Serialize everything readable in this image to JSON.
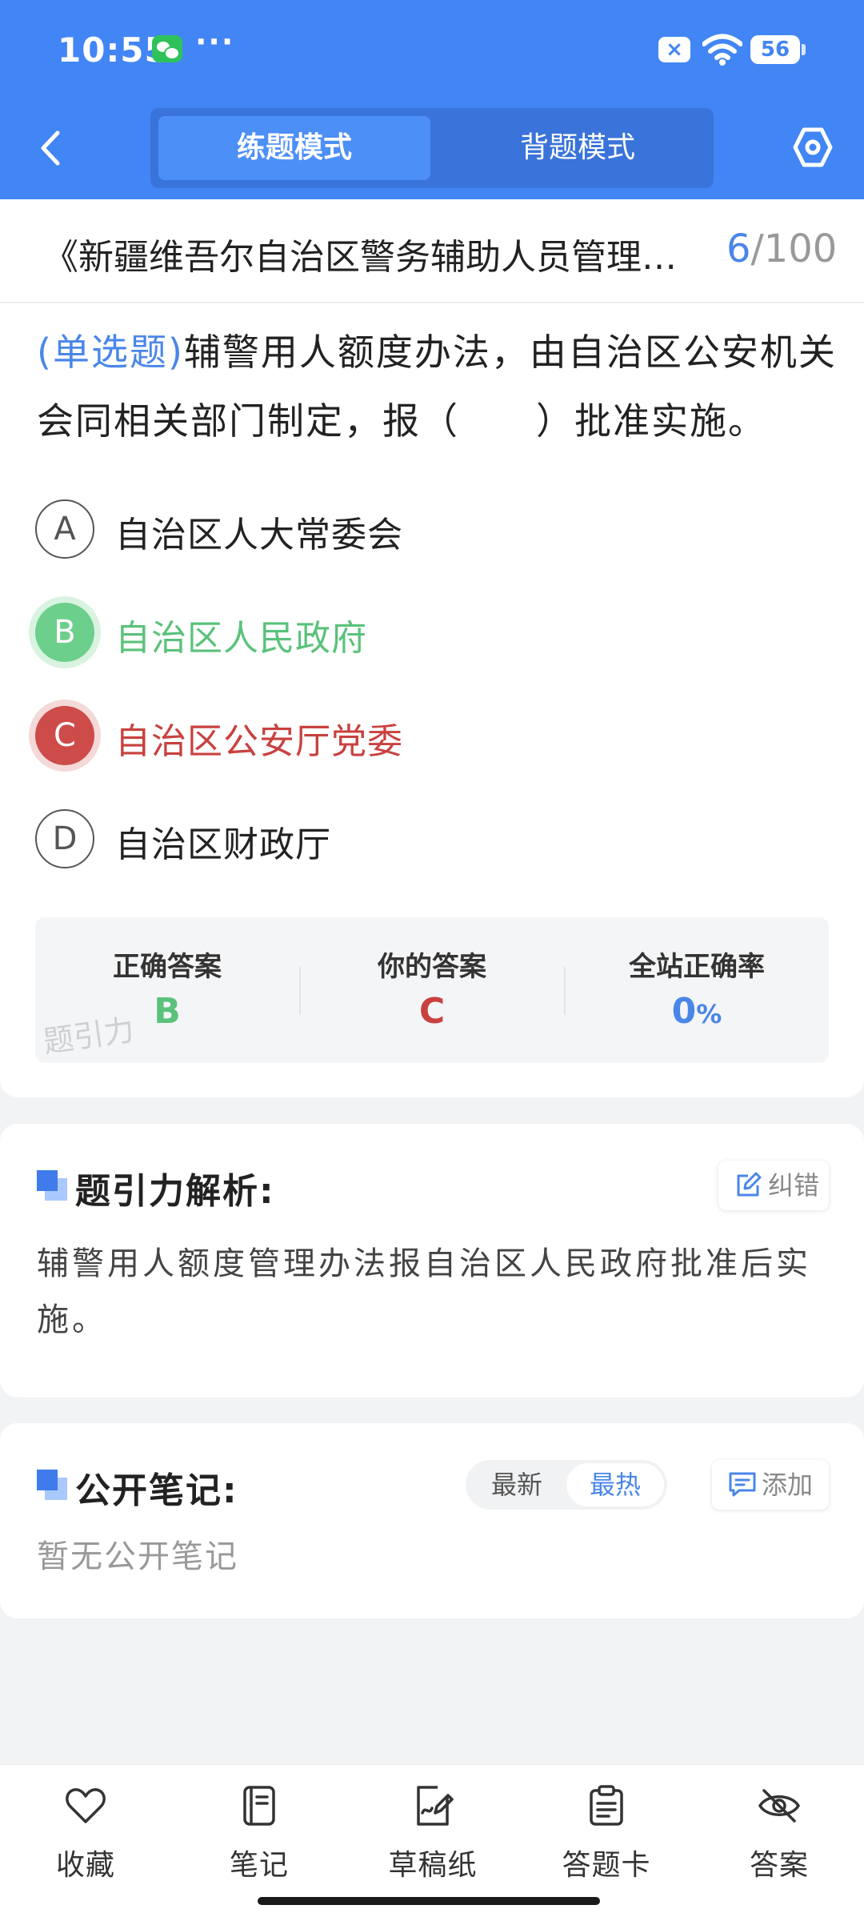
{
  "status_bar": {
    "time": "10:55",
    "dots": "···",
    "sim_badge": "×",
    "battery": "56"
  },
  "header": {
    "mode_practice": "练题模式",
    "mode_memorize": "背题模式"
  },
  "question": {
    "doc_title": "《新疆维吾尔自治区警务辅助人员管理办法》",
    "current": "6",
    "separator": "/",
    "total": "100",
    "type_label": "(单选题)",
    "text": "辅警用人额度办法，由自治区公安机关会同相关部门制定，报（　　）批准实施。",
    "options": [
      {
        "letter": "A",
        "text": "自治区人大常委会",
        "state": "normal"
      },
      {
        "letter": "B",
        "text": "自治区人民政府",
        "state": "correct"
      },
      {
        "letter": "C",
        "text": "自治区公安厅党委",
        "state": "wrong"
      },
      {
        "letter": "D",
        "text": "自治区财政厅",
        "state": "normal"
      }
    ]
  },
  "answer_summary": {
    "correct_label": "正确答案",
    "correct_value": "B",
    "yours_label": "你的答案",
    "yours_value": "C",
    "rate_label": "全站正确率",
    "rate_value": "0",
    "rate_unit": "%",
    "watermark": "题引力"
  },
  "analysis": {
    "title": "题引力解析:",
    "report_label": "纠错",
    "text": "辅警用人额度管理办法报自治区人民政府批准后实施。"
  },
  "notes": {
    "title": "公开笔记:",
    "sort_latest": "最新",
    "sort_hot": "最热",
    "add_label": "添加",
    "empty_text": "暂无公开笔记"
  },
  "bottom_nav": {
    "favorite": "收藏",
    "notes": "笔记",
    "scratch": "草稿纸",
    "answer_card": "答题卡",
    "answer": "答案"
  },
  "colors": {
    "primary": "#4285f4",
    "correct": "#5ac27a",
    "wrong": "#c8413f",
    "accent_blue": "#4a86e8"
  }
}
